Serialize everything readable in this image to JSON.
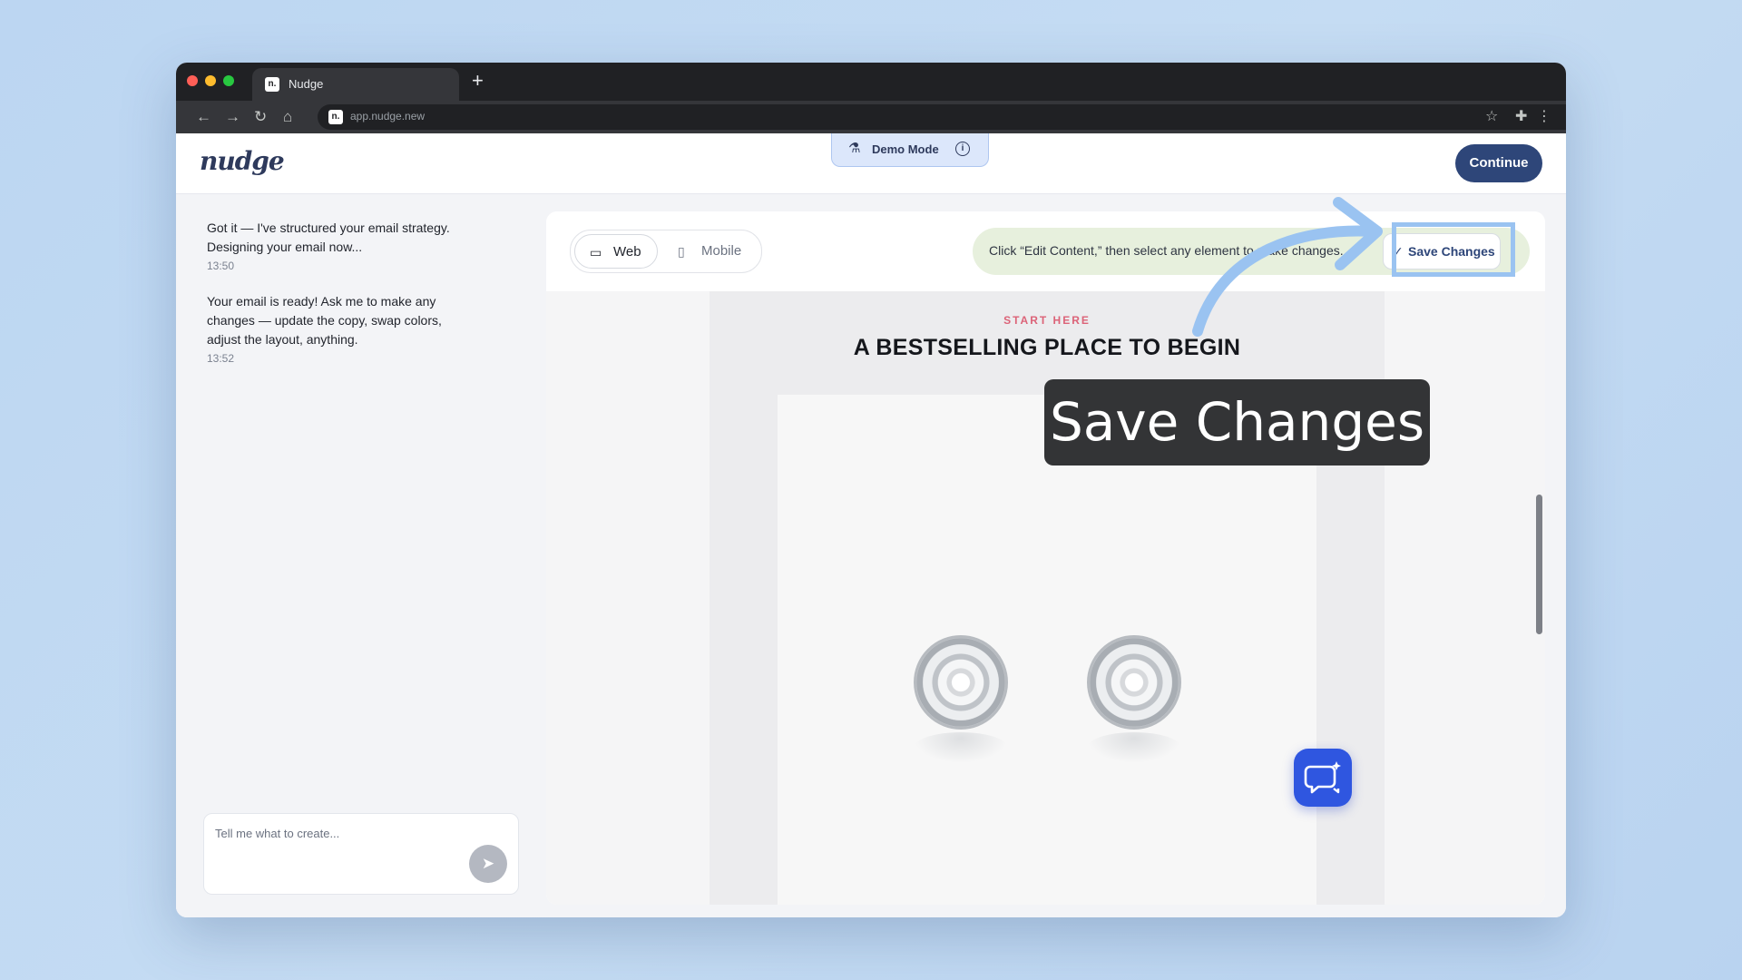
{
  "browser": {
    "tab_title": "Nudge",
    "tab_favicon": "n.",
    "new_tab": "+",
    "url": "app.nudge.new",
    "icons": [
      "back-icon",
      "forward-icon",
      "reload-icon",
      "home-icon",
      "bookmark-star-icon",
      "extensions-icon",
      "menu-icon"
    ]
  },
  "header": {
    "logo": "nudge",
    "demo_mode": "Demo Mode",
    "continue": "Continue"
  },
  "chat": {
    "messages": [
      {
        "text": "Got it — I've structured your email strategy. Designing your email now...",
        "time": "13:50"
      },
      {
        "text": "Your email is ready! Ask me to make any changes — update the copy, swap colors, adjust the layout, anything.",
        "time": "13:52"
      }
    ],
    "input_placeholder": "Tell me what to create..."
  },
  "editor": {
    "view_web": "Web",
    "view_mobile": "Mobile",
    "hint": "Click “Edit Content,” then select any element to make changes.",
    "save_changes": "Save Changes",
    "save_check": "✓"
  },
  "email": {
    "eyebrow": "START HERE",
    "headline": "A BESTSELLING PLACE TO BEGIN"
  },
  "overlay": {
    "tooltip": "Save Changes",
    "accent_color": "#9ac3f1"
  },
  "colors": {
    "primary": "#2e4679",
    "hint_bg": "#e7f0dd",
    "eyebrow": "#dc6378",
    "fab": "#2f56e0"
  }
}
